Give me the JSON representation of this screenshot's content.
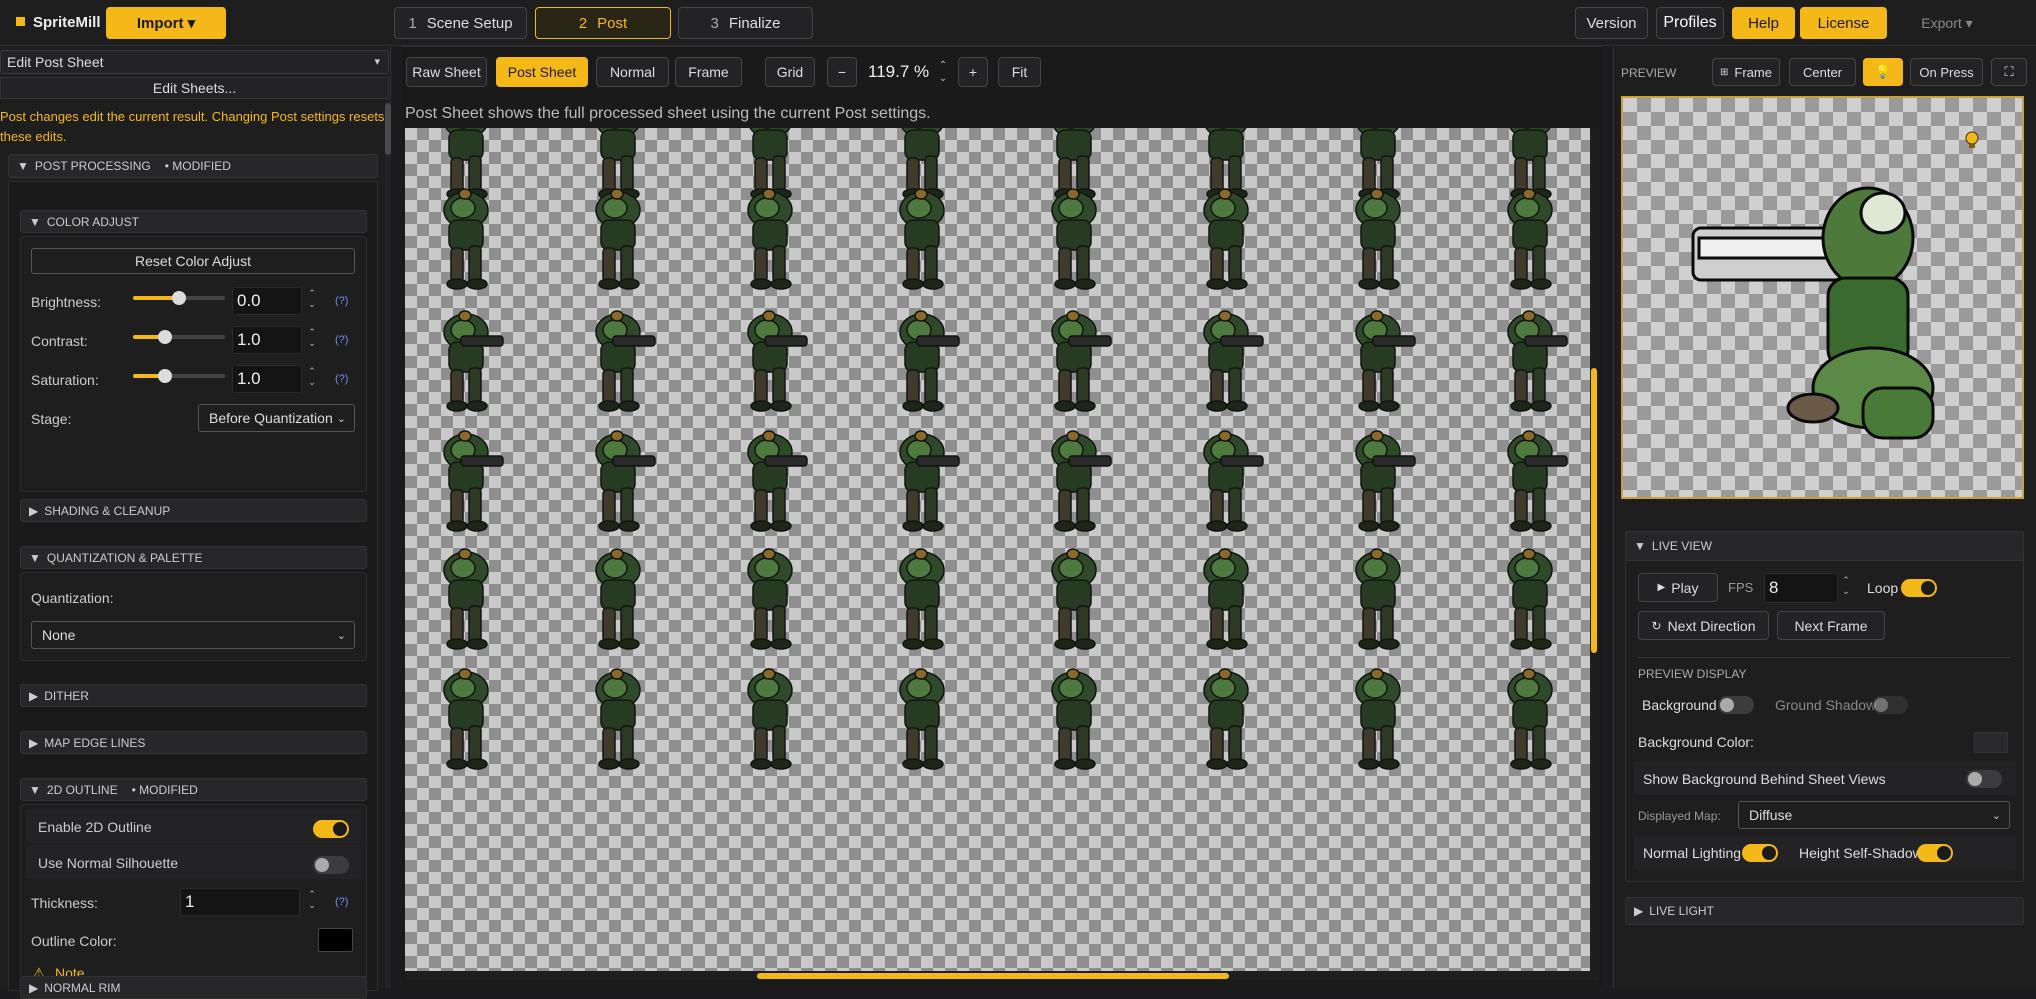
{
  "app": {
    "logo_text": "SpriteMill",
    "import_label": "Import ▾"
  },
  "steps": [
    {
      "num": "1",
      "label": "Scene Setup"
    },
    {
      "num": "2",
      "label": "Post"
    },
    {
      "num": "3",
      "label": "Finalize"
    }
  ],
  "topright": {
    "version": "Version",
    "profiles": "Profiles",
    "help": "Help",
    "license": "License",
    "export": "Export ▾"
  },
  "left": {
    "mode_select": "Edit Post Sheet",
    "edit_sheets": "Edit Sheets...",
    "warning": "Post changes edit the current result. Changing Post settings resets these edits.",
    "post_processing": "POST PROCESSING",
    "modified": "• MODIFIED",
    "color_adjust": "COLOR ADJUST",
    "reset_color": "Reset Color Adjust",
    "brightness_label": "Brightness:",
    "brightness_value": "0.0",
    "brightness_level": 0.5,
    "contrast_label": "Contrast:",
    "contrast_value": "1.0",
    "contrast_level": 0.35,
    "saturation_label": "Saturation:",
    "saturation_value": "1.0",
    "saturation_level": 0.35,
    "help": "(?)",
    "stage_label": "Stage:",
    "stage_value": "Before Quantization",
    "shading": "SHADING & CLEANUP",
    "quant": "QUANTIZATION & PALETTE",
    "quant_label": "Quantization:",
    "quant_value": "None",
    "dither": "DITHER",
    "edge": "MAP EDGE LINES",
    "outline": "2D OUTLINE",
    "outline_modified": "• MODIFIED",
    "enable_outline": "Enable 2D Outline",
    "normal_sil": "Use Normal Silhouette",
    "thickness_label": "Thickness:",
    "thickness_value": "1",
    "outline_color_label": "Outline Color:",
    "note": "Note",
    "normal_rim": "NORMAL RIM"
  },
  "center": {
    "tabs": [
      "Raw Sheet",
      "Post Sheet",
      "Normal",
      "Frame"
    ],
    "grid": "Grid",
    "minus": "−",
    "zoom": "119.7 %",
    "plus": "+",
    "fit": "Fit",
    "info": "Post Sheet shows the full processed sheet using the current Post settings."
  },
  "right": {
    "preview_label": "PREVIEW",
    "frame": "Frame",
    "center": "Center",
    "on_press": "On Press",
    "live_view": "LIVE VIEW",
    "play": "Play",
    "fps_label": "FPS",
    "fps_value": "8",
    "loop": "Loop",
    "next_direction": "Next Direction",
    "next_frame": "Next Frame",
    "preview_display": "PREVIEW DISPLAY",
    "background": "Background",
    "ground_shadow": "Ground Shadow",
    "bg_color": "Background Color:",
    "show_bg": "Show Background Behind Sheet Views",
    "displayed_map_label": "Displayed Map:",
    "displayed_map_value": "Diffuse",
    "normal_lighting": "Normal Lighting",
    "height_shadow": "Height Self-Shadow",
    "live_light": "LIVE LIGHT"
  },
  "colors": {
    "accent": "#f5b819",
    "warning": "#f5b819",
    "outline_color": "#000000"
  }
}
